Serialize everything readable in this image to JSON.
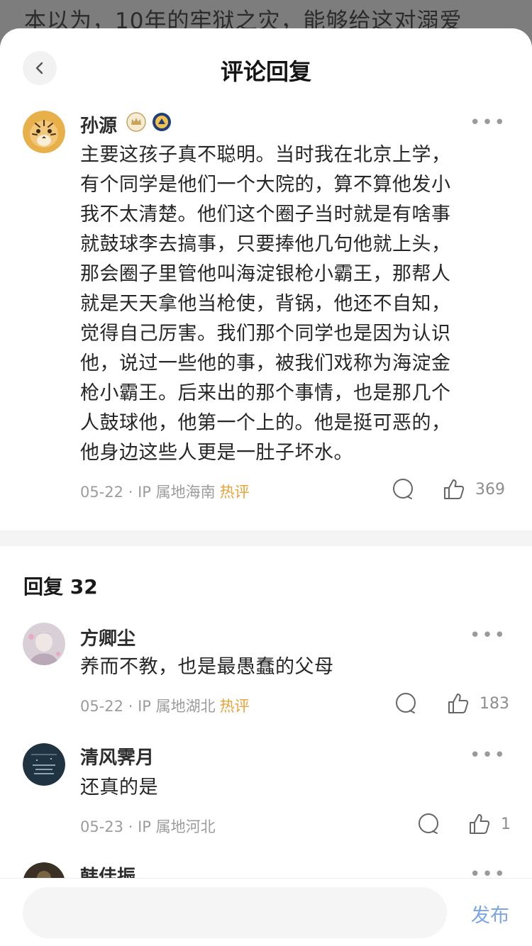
{
  "background": {
    "text": "本以为，10年的牢狱之灾，能够给这对溺爱"
  },
  "header": {
    "title": "评论回复"
  },
  "main_comment": {
    "user": "孙源",
    "lines": [
      "主要这孩子真不聪明。当时我在北京上学，",
      "有个同学是他们一个大院的，算不算他发小",
      "我不太清楚。他们这个圈子当时就是有啥事",
      "就鼓球李去搞事，只要捧他几句他就上头，",
      "那会圈子里管他叫海淀银枪小霸王，那帮人",
      "就是天天拿他当枪使，背锅，他还不自知，",
      "觉得自己厉害。我们那个同学也是因为认识",
      "他，说过一些他的事，被我们戏称为海淀金",
      "枪小霸王。后来出的那个事情，也是那几个",
      "人鼓球他，他第一个上的。他是挺可恶的，",
      "他身边这些人更是一肚子坏水。"
    ],
    "date": "05-22",
    "location": "IP 属地海南",
    "hot": "热评",
    "likes": "369"
  },
  "replies_header": {
    "label": "回复 32"
  },
  "replies": [
    {
      "user": "方卿尘",
      "text": "养而不教，也是最愚蠢的父母",
      "date": "05-22",
      "location": "IP 属地湖北",
      "hot": "热评",
      "likes": "183"
    },
    {
      "user": "清风霁月",
      "text": "还真的是",
      "date": "05-23",
      "location": "IP 属地河北",
      "hot": "",
      "likes": "1"
    },
    {
      "user": "韩佳振"
    }
  ],
  "bottom": {
    "publish": "发布"
  },
  "colors": {
    "hot": "#e8a33a",
    "publish": "#7aa6e8"
  }
}
